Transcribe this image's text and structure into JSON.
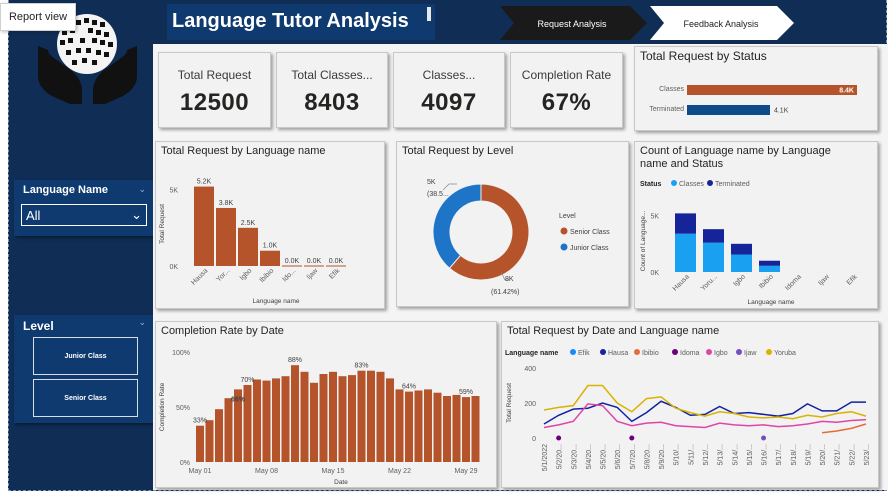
{
  "toolbar": {
    "report_view_label": "Report view"
  },
  "header": {
    "title": "Language Tutor Analysis",
    "nav_request": "Request Analysis",
    "nav_feedback": "Feedback Analysis"
  },
  "kpis": [
    {
      "label": "Total Request",
      "value": "12500"
    },
    {
      "label": "Total Classes...",
      "value": "8403"
    },
    {
      "label": "Classes...",
      "value": "4097"
    },
    {
      "label": "Completion Rate",
      "value": "67%"
    }
  ],
  "slicers": {
    "language": {
      "title": "Language Name",
      "selected": "All"
    },
    "level": {
      "title": "Level",
      "options": [
        "Junior Class",
        "Senior Class"
      ]
    }
  },
  "colors": {
    "bar": "#b5532a",
    "dark_blue": "#0f2d55",
    "mid_blue": "#1e74c6",
    "light_blue": "#1aa0f0",
    "navy": "#16249a"
  },
  "chart_data": [
    {
      "id": "status",
      "type": "bar",
      "orientation": "horizontal",
      "title": "Total Request by Status",
      "categories": [
        "Classes",
        "Terminated"
      ],
      "values": [
        8400,
        4100
      ],
      "data_labels": [
        "8.4K",
        "4.1K"
      ],
      "colors": [
        "#b5532a",
        "#0f4a8a"
      ]
    },
    {
      "id": "language",
      "type": "bar",
      "title": "Total Request by Language name",
      "xlabel": "Language name",
      "ylabel": "Total Request",
      "categories": [
        "Hausa",
        "Yor...",
        "Igbo",
        "Ibibio",
        "Ido...",
        "Ijaw",
        "Efik"
      ],
      "values": [
        5200,
        3800,
        2500,
        1000,
        0,
        0,
        0
      ],
      "data_labels": [
        "5.2K",
        "3.8K",
        "2.5K",
        "1.0K",
        "0.0K",
        "0.0K",
        "0.0K"
      ],
      "yticks": [
        "0K",
        "5K"
      ],
      "ylim": [
        0,
        5500
      ]
    },
    {
      "id": "level",
      "type": "pie",
      "title": "Total Request by Level",
      "legend_title": "Level",
      "slices": [
        {
          "name": "Senior Class",
          "value": 61.42,
          "label_top": "8K",
          "label_bottom": "(61.42%)",
          "color": "#b5532a"
        },
        {
          "name": "Junior Class",
          "value": 38.58,
          "label_top": "5K",
          "label_bottom": "(38.5...",
          "color": "#1e74c6"
        }
      ]
    },
    {
      "id": "lang_status",
      "type": "bar",
      "stacked": true,
      "title": "Count of Language name by Language name and Status",
      "legend_title": "Status",
      "xlabel": "Language name",
      "ylabel": "Count of Language...",
      "categories": [
        "Hausa",
        "Yoru...",
        "Igbo",
        "Ibibio",
        "Idoma",
        "Ijaw",
        "Efik"
      ],
      "yticks": [
        "0K",
        "5K"
      ],
      "ylim": [
        0,
        5500
      ],
      "series": [
        {
          "name": "Classes",
          "color": "#1aa0f0",
          "values": [
            3400,
            2600,
            1550,
            550,
            0,
            0,
            0
          ]
        },
        {
          "name": "Terminated",
          "color": "#16249a",
          "values": [
            1800,
            1200,
            950,
            450,
            0,
            0,
            0
          ]
        }
      ]
    },
    {
      "id": "completion",
      "type": "bar",
      "title": "Completion Rate by Date",
      "xlabel": "Date",
      "ylabel": "Completion Rate",
      "yticks": [
        "0%",
        "50%",
        "100%"
      ],
      "ylim": [
        0,
        100
      ],
      "xticks": [
        "May 01",
        "May 08",
        "May 15",
        "May 22",
        "May 29"
      ],
      "values": [
        33,
        38,
        48,
        58,
        66,
        70,
        75,
        74,
        76,
        78,
        88,
        82,
        72,
        80,
        82,
        78,
        79,
        83,
        83,
        82,
        76,
        66,
        64,
        65,
        66,
        63,
        60,
        61,
        59,
        60
      ],
      "data_labels": [
        {
          "index": 0,
          "text": "33%"
        },
        {
          "index": 4,
          "text": "66%"
        },
        {
          "index": 5,
          "text": "70%"
        },
        {
          "index": 10,
          "text": "88%"
        },
        {
          "index": 17,
          "text": "83%"
        },
        {
          "index": 22,
          "text": "64%"
        },
        {
          "index": 28,
          "text": "59%"
        }
      ]
    },
    {
      "id": "date_lang",
      "type": "line",
      "title": "Total Request by Date and Language name",
      "legend_title": "Language name",
      "ylabel": "Total Request",
      "yticks": [
        "0",
        "200",
        "400"
      ],
      "ylim": [
        0,
        400
      ],
      "xticks": [
        "5/1/2022",
        "5/2/20...",
        "5/3/20...",
        "5/4/20...",
        "5/5/20...",
        "5/6/20...",
        "5/7/20...",
        "5/8/20...",
        "5/9/20...",
        "5/10/...",
        "5/11/...",
        "5/12/...",
        "5/13/...",
        "5/14/...",
        "5/15/...",
        "5/16/...",
        "5/17/...",
        "5/18/...",
        "5/19/...",
        "5/20/...",
        "5/21/...",
        "5/22/...",
        "5/23/..."
      ],
      "series": [
        {
          "name": "Efik",
          "color": "#118dff",
          "values": [
            null,
            null,
            null,
            null,
            null,
            null,
            null,
            null,
            null,
            null,
            null,
            null,
            null,
            null,
            null,
            null,
            null,
            null,
            null,
            null,
            null,
            null,
            null
          ]
        },
        {
          "name": "Hausa",
          "color": "#12239e",
          "values": [
            80,
            130,
            165,
            170,
            200,
            175,
            95,
            145,
            210,
            175,
            130,
            135,
            180,
            140,
            145,
            135,
            125,
            140,
            195,
            155,
            155,
            205,
            205
          ]
        },
        {
          "name": "Ibibio",
          "color": "#e66c37",
          "values": [
            null,
            null,
            null,
            null,
            null,
            null,
            null,
            null,
            null,
            null,
            null,
            null,
            null,
            null,
            null,
            null,
            null,
            null,
            null,
            30,
            40,
            55,
            80
          ]
        },
        {
          "name": "Idoma",
          "color": "#6b007b",
          "values": [
            null,
            0,
            null,
            null,
            null,
            null,
            0,
            null,
            null,
            null,
            null,
            null,
            null,
            null,
            null,
            null,
            null,
            null,
            null,
            null,
            null,
            null,
            null
          ]
        },
        {
          "name": "Igbo",
          "color": "#e044a7",
          "values": [
            60,
            75,
            95,
            195,
            185,
            95,
            70,
            85,
            90,
            70,
            65,
            60,
            85,
            75,
            70,
            75,
            65,
            70,
            80,
            95,
            90,
            100,
            105
          ]
        },
        {
          "name": "Ijaw",
          "color": "#744ec2",
          "values": [
            null,
            null,
            null,
            null,
            null,
            null,
            null,
            null,
            null,
            null,
            null,
            null,
            null,
            null,
            null,
            0,
            null,
            null,
            null,
            null,
            null,
            null,
            null
          ]
        },
        {
          "name": "Yoruba",
          "color": "#d9b300",
          "values": [
            160,
            175,
            185,
            300,
            300,
            200,
            150,
            225,
            235,
            170,
            145,
            125,
            150,
            140,
            120,
            115,
            120,
            110,
            130,
            120,
            140,
            150,
            125
          ]
        }
      ]
    }
  ]
}
